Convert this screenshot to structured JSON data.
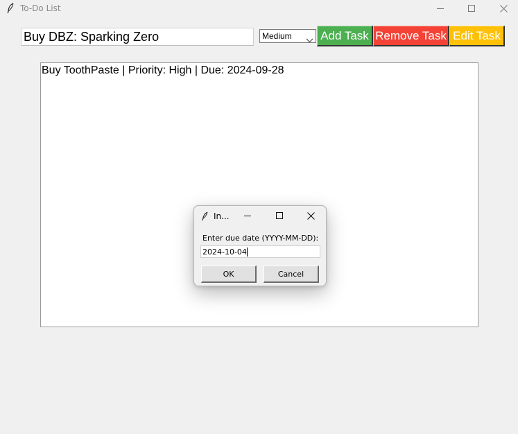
{
  "window": {
    "title": "To-Do List",
    "icon": "feather-icon",
    "controls": [
      "minimize-icon",
      "maximize-icon",
      "close-icon"
    ]
  },
  "toolbar": {
    "task_input_value": "Buy DBZ: Sparking Zero",
    "priority_selected": "Medium",
    "add_label": "Add Task",
    "remove_label": "Remove Task",
    "edit_label": "Edit Task",
    "colors": {
      "add": "#4caf50",
      "remove": "#f44336",
      "edit": "#ffc107"
    }
  },
  "tasks": [
    "Buy ToothPaste | Priority: High | Due: 2024-09-28"
  ],
  "dialog": {
    "title": "In...",
    "prompt": "Enter due date (YYYY-MM-DD):",
    "input_value": "2024-10-04",
    "ok_label": "OK",
    "cancel_label": "Cancel"
  }
}
